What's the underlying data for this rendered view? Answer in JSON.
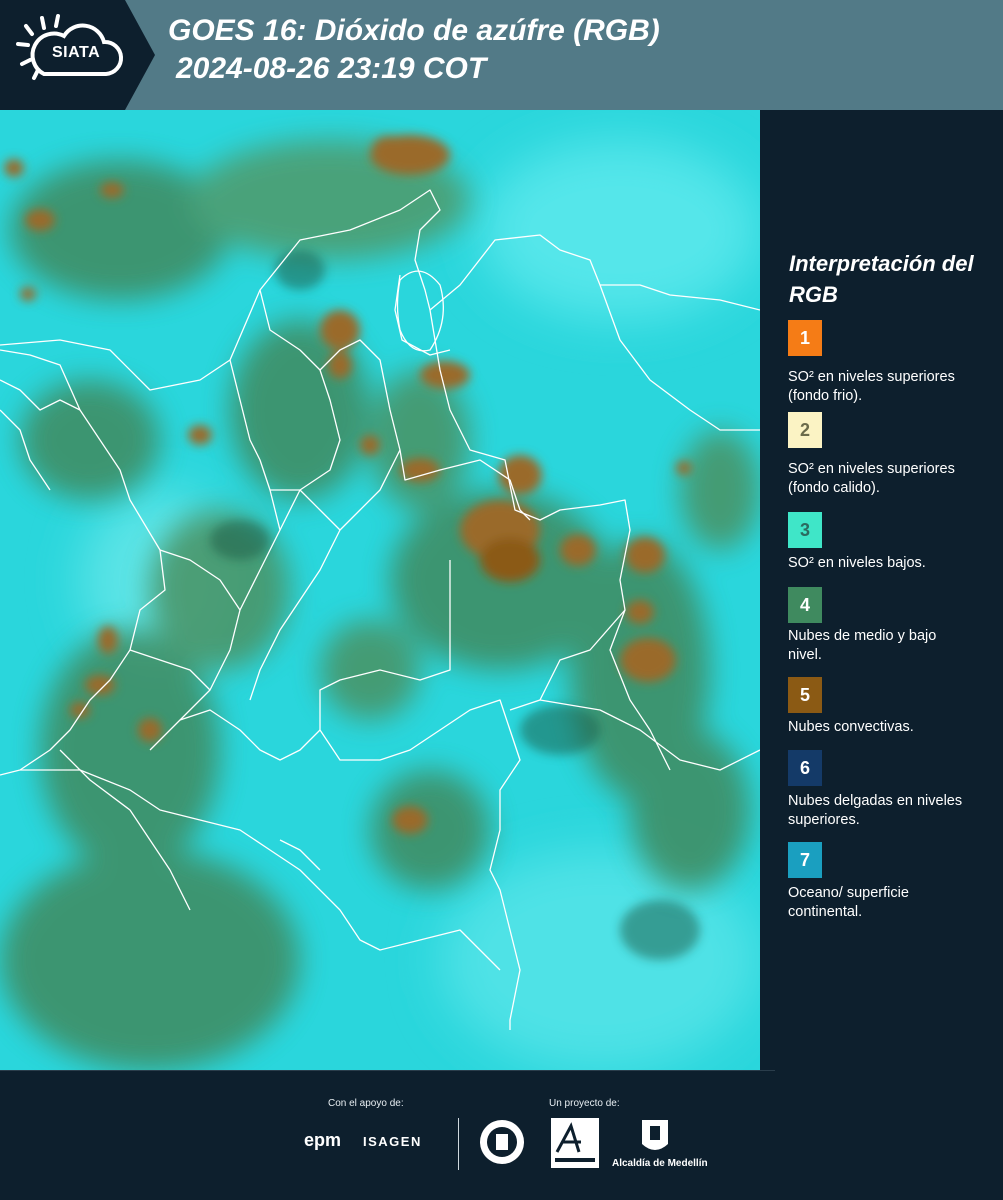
{
  "header": {
    "title_line1": "GOES 16: Dióxido de azúfre (RGB)",
    "title_line2": "2024-08-26 23:19 COT",
    "logo_text": "SIATA"
  },
  "legend": {
    "title": "Interpretación del RGB",
    "items": [
      {
        "number": "1",
        "label": "SO² en niveles superiores (fondo frio).",
        "color": "#f57c16",
        "text_color": "#ffffff"
      },
      {
        "number": "2",
        "label": "SO² en niveles superiores (fondo calido).",
        "color": "#fbf3c4",
        "text_color": "#6b6b4b"
      },
      {
        "number": "3",
        "label": "SO² en niveles bajos.",
        "color": "#3fe6c8",
        "text_color": "#2b6b60"
      },
      {
        "number": "4",
        "label": "Nubes de medio y bajo nivel.",
        "color": "#3f8a5f",
        "text_color": "#ffffff"
      },
      {
        "number": "5",
        "label": "Nubes convectivas.",
        "color": "#8b5a14",
        "text_color": "#ffffff"
      },
      {
        "number": "6",
        "label": "Nubes delgadas en niveles superiores.",
        "color": "#143a68",
        "text_color": "#ffffff"
      },
      {
        "number": "7",
        "label": "Oceano/ superficie continental.",
        "color": "#1a9fc0",
        "text_color": "#ffffff"
      }
    ]
  },
  "footer": {
    "support_label": "Con el apoyo de:",
    "project_label": "Un proyecto de:",
    "epm": "epm",
    "isagen": "ISAGEN",
    "alcaldia": "Alcaldía de Medellín"
  },
  "map": {
    "background_color": "#2ad6dc",
    "cloud_color": "#3f8a5f",
    "convective_color": "#8b5a14"
  }
}
